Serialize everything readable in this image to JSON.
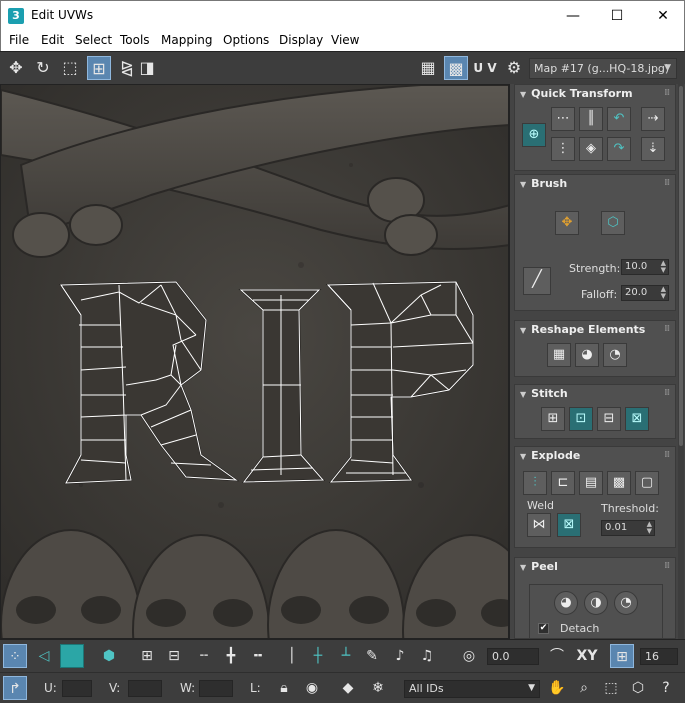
{
  "window": {
    "title": "Edit UVWs",
    "app_icon_text": "3",
    "minimize": "—",
    "maximize": "☐",
    "close": "✕"
  },
  "menu": [
    "File",
    "Edit",
    "Select",
    "Tools",
    "Mapping",
    "Options",
    "Display",
    "View"
  ],
  "top_toolbar": {
    "uv_label": "U V",
    "map_select": "Map #17 (g...HQ-18.jpg)"
  },
  "panel": {
    "quick_transform": {
      "title": "Quick Transform"
    },
    "brush": {
      "title": "Brush",
      "strength_label": "Strength:",
      "strength_value": "10.0",
      "falloff_label": "Falloff:",
      "falloff_value": "20.0"
    },
    "reshape": {
      "title": "Reshape Elements"
    },
    "stitch": {
      "title": "Stitch"
    },
    "explode": {
      "title": "Explode",
      "weld_label": "Weld",
      "threshold_label": "Threshold:",
      "threshold_value": "0.01"
    },
    "peel": {
      "title": "Peel",
      "detach_label": "Detach",
      "detach_checked": true
    }
  },
  "bottom_toolbar1": {
    "rotate_value": "0.0",
    "xy_label": "XY",
    "grid_value": "16"
  },
  "bottom_toolbar2": {
    "u_label": "U:",
    "v_label": "V:",
    "w_label": "W:",
    "l_label": "L:",
    "ids_select": "All IDs"
  },
  "colors": {
    "accent_blue": "#5a86b0",
    "teal": "#2a6f74",
    "panel_bg": "#444444"
  }
}
